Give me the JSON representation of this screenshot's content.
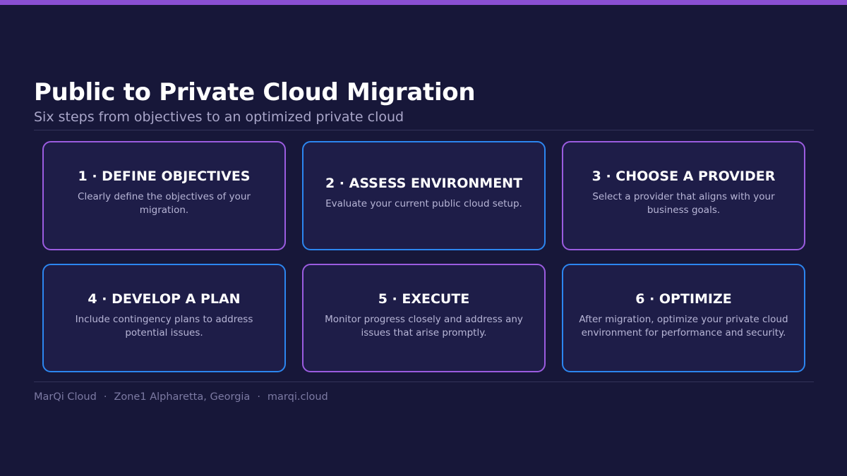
{
  "title": "Public to Private Cloud Migration",
  "subtitle": "Six steps from objectives to an optimized private cloud",
  "colors": {
    "background": "#171739",
    "accent_purple": "#9b5ce0",
    "accent_blue": "#2c86f0",
    "card_fill": "#1e1d48"
  },
  "steps": [
    {
      "title": "1 · DEFINE OBJECTIVES",
      "description": "Clearly define the objectives of your migration.",
      "border": "purple"
    },
    {
      "title": "2 · ASSESS ENVIRONMENT",
      "description": "Evaluate your current public cloud setup.",
      "border": "blue"
    },
    {
      "title": "3 · CHOOSE A PROVIDER",
      "description": "Select a provider that aligns with your business goals.",
      "border": "purple"
    },
    {
      "title": "4 · DEVELOP A PLAN",
      "description": "Include contingency plans to address potential issues.",
      "border": "blue"
    },
    {
      "title": "5 · EXECUTE",
      "description": "Monitor progress closely and address any issues that arise promptly.",
      "border": "purple"
    },
    {
      "title": "6 · OPTIMIZE",
      "description": "After migration, optimize your private cloud environment for performance and security.",
      "border": "blue"
    }
  ],
  "footer": {
    "company": "MarQi Cloud",
    "location": "Zone1 Alpharetta, Georgia",
    "website": "marqi.cloud",
    "separator": "·"
  }
}
